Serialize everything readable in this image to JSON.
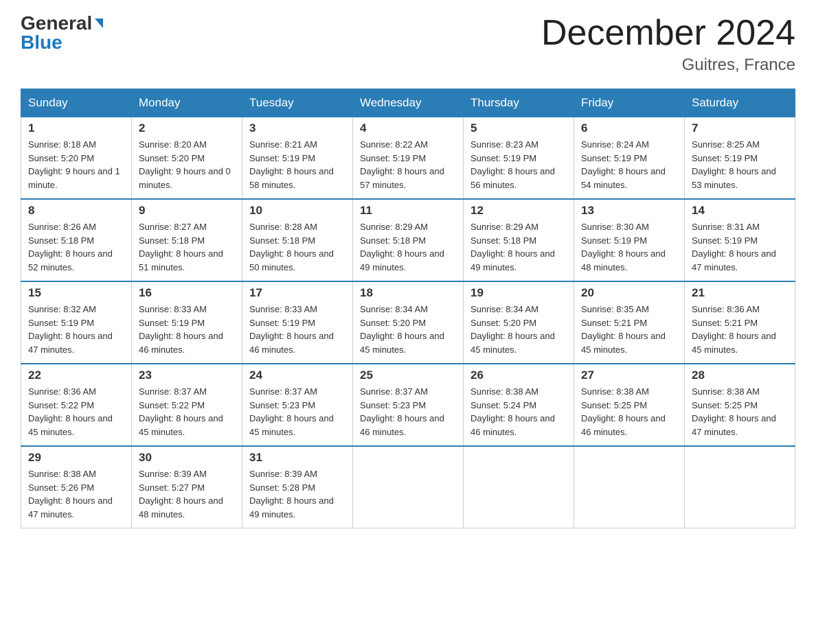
{
  "logo": {
    "general": "General",
    "blue": "Blue"
  },
  "title": {
    "month": "December 2024",
    "location": "Guitres, France"
  },
  "weekdays": [
    "Sunday",
    "Monday",
    "Tuesday",
    "Wednesday",
    "Thursday",
    "Friday",
    "Saturday"
  ],
  "weeks": [
    [
      {
        "day": "1",
        "sunrise": "Sunrise: 8:18 AM",
        "sunset": "Sunset: 5:20 PM",
        "daylight": "Daylight: 9 hours and 1 minute."
      },
      {
        "day": "2",
        "sunrise": "Sunrise: 8:20 AM",
        "sunset": "Sunset: 5:20 PM",
        "daylight": "Daylight: 9 hours and 0 minutes."
      },
      {
        "day": "3",
        "sunrise": "Sunrise: 8:21 AM",
        "sunset": "Sunset: 5:19 PM",
        "daylight": "Daylight: 8 hours and 58 minutes."
      },
      {
        "day": "4",
        "sunrise": "Sunrise: 8:22 AM",
        "sunset": "Sunset: 5:19 PM",
        "daylight": "Daylight: 8 hours and 57 minutes."
      },
      {
        "day": "5",
        "sunrise": "Sunrise: 8:23 AM",
        "sunset": "Sunset: 5:19 PM",
        "daylight": "Daylight: 8 hours and 56 minutes."
      },
      {
        "day": "6",
        "sunrise": "Sunrise: 8:24 AM",
        "sunset": "Sunset: 5:19 PM",
        "daylight": "Daylight: 8 hours and 54 minutes."
      },
      {
        "day": "7",
        "sunrise": "Sunrise: 8:25 AM",
        "sunset": "Sunset: 5:19 PM",
        "daylight": "Daylight: 8 hours and 53 minutes."
      }
    ],
    [
      {
        "day": "8",
        "sunrise": "Sunrise: 8:26 AM",
        "sunset": "Sunset: 5:18 PM",
        "daylight": "Daylight: 8 hours and 52 minutes."
      },
      {
        "day": "9",
        "sunrise": "Sunrise: 8:27 AM",
        "sunset": "Sunset: 5:18 PM",
        "daylight": "Daylight: 8 hours and 51 minutes."
      },
      {
        "day": "10",
        "sunrise": "Sunrise: 8:28 AM",
        "sunset": "Sunset: 5:18 PM",
        "daylight": "Daylight: 8 hours and 50 minutes."
      },
      {
        "day": "11",
        "sunrise": "Sunrise: 8:29 AM",
        "sunset": "Sunset: 5:18 PM",
        "daylight": "Daylight: 8 hours and 49 minutes."
      },
      {
        "day": "12",
        "sunrise": "Sunrise: 8:29 AM",
        "sunset": "Sunset: 5:18 PM",
        "daylight": "Daylight: 8 hours and 49 minutes."
      },
      {
        "day": "13",
        "sunrise": "Sunrise: 8:30 AM",
        "sunset": "Sunset: 5:19 PM",
        "daylight": "Daylight: 8 hours and 48 minutes."
      },
      {
        "day": "14",
        "sunrise": "Sunrise: 8:31 AM",
        "sunset": "Sunset: 5:19 PM",
        "daylight": "Daylight: 8 hours and 47 minutes."
      }
    ],
    [
      {
        "day": "15",
        "sunrise": "Sunrise: 8:32 AM",
        "sunset": "Sunset: 5:19 PM",
        "daylight": "Daylight: 8 hours and 47 minutes."
      },
      {
        "day": "16",
        "sunrise": "Sunrise: 8:33 AM",
        "sunset": "Sunset: 5:19 PM",
        "daylight": "Daylight: 8 hours and 46 minutes."
      },
      {
        "day": "17",
        "sunrise": "Sunrise: 8:33 AM",
        "sunset": "Sunset: 5:19 PM",
        "daylight": "Daylight: 8 hours and 46 minutes."
      },
      {
        "day": "18",
        "sunrise": "Sunrise: 8:34 AM",
        "sunset": "Sunset: 5:20 PM",
        "daylight": "Daylight: 8 hours and 45 minutes."
      },
      {
        "day": "19",
        "sunrise": "Sunrise: 8:34 AM",
        "sunset": "Sunset: 5:20 PM",
        "daylight": "Daylight: 8 hours and 45 minutes."
      },
      {
        "day": "20",
        "sunrise": "Sunrise: 8:35 AM",
        "sunset": "Sunset: 5:21 PM",
        "daylight": "Daylight: 8 hours and 45 minutes."
      },
      {
        "day": "21",
        "sunrise": "Sunrise: 8:36 AM",
        "sunset": "Sunset: 5:21 PM",
        "daylight": "Daylight: 8 hours and 45 minutes."
      }
    ],
    [
      {
        "day": "22",
        "sunrise": "Sunrise: 8:36 AM",
        "sunset": "Sunset: 5:22 PM",
        "daylight": "Daylight: 8 hours and 45 minutes."
      },
      {
        "day": "23",
        "sunrise": "Sunrise: 8:37 AM",
        "sunset": "Sunset: 5:22 PM",
        "daylight": "Daylight: 8 hours and 45 minutes."
      },
      {
        "day": "24",
        "sunrise": "Sunrise: 8:37 AM",
        "sunset": "Sunset: 5:23 PM",
        "daylight": "Daylight: 8 hours and 45 minutes."
      },
      {
        "day": "25",
        "sunrise": "Sunrise: 8:37 AM",
        "sunset": "Sunset: 5:23 PM",
        "daylight": "Daylight: 8 hours and 46 minutes."
      },
      {
        "day": "26",
        "sunrise": "Sunrise: 8:38 AM",
        "sunset": "Sunset: 5:24 PM",
        "daylight": "Daylight: 8 hours and 46 minutes."
      },
      {
        "day": "27",
        "sunrise": "Sunrise: 8:38 AM",
        "sunset": "Sunset: 5:25 PM",
        "daylight": "Daylight: 8 hours and 46 minutes."
      },
      {
        "day": "28",
        "sunrise": "Sunrise: 8:38 AM",
        "sunset": "Sunset: 5:25 PM",
        "daylight": "Daylight: 8 hours and 47 minutes."
      }
    ],
    [
      {
        "day": "29",
        "sunrise": "Sunrise: 8:38 AM",
        "sunset": "Sunset: 5:26 PM",
        "daylight": "Daylight: 8 hours and 47 minutes."
      },
      {
        "day": "30",
        "sunrise": "Sunrise: 8:39 AM",
        "sunset": "Sunset: 5:27 PM",
        "daylight": "Daylight: 8 hours and 48 minutes."
      },
      {
        "day": "31",
        "sunrise": "Sunrise: 8:39 AM",
        "sunset": "Sunset: 5:28 PM",
        "daylight": "Daylight: 8 hours and 49 minutes."
      },
      {
        "day": "",
        "sunrise": "",
        "sunset": "",
        "daylight": ""
      },
      {
        "day": "",
        "sunrise": "",
        "sunset": "",
        "daylight": ""
      },
      {
        "day": "",
        "sunrise": "",
        "sunset": "",
        "daylight": ""
      },
      {
        "day": "",
        "sunrise": "",
        "sunset": "",
        "daylight": ""
      }
    ]
  ]
}
